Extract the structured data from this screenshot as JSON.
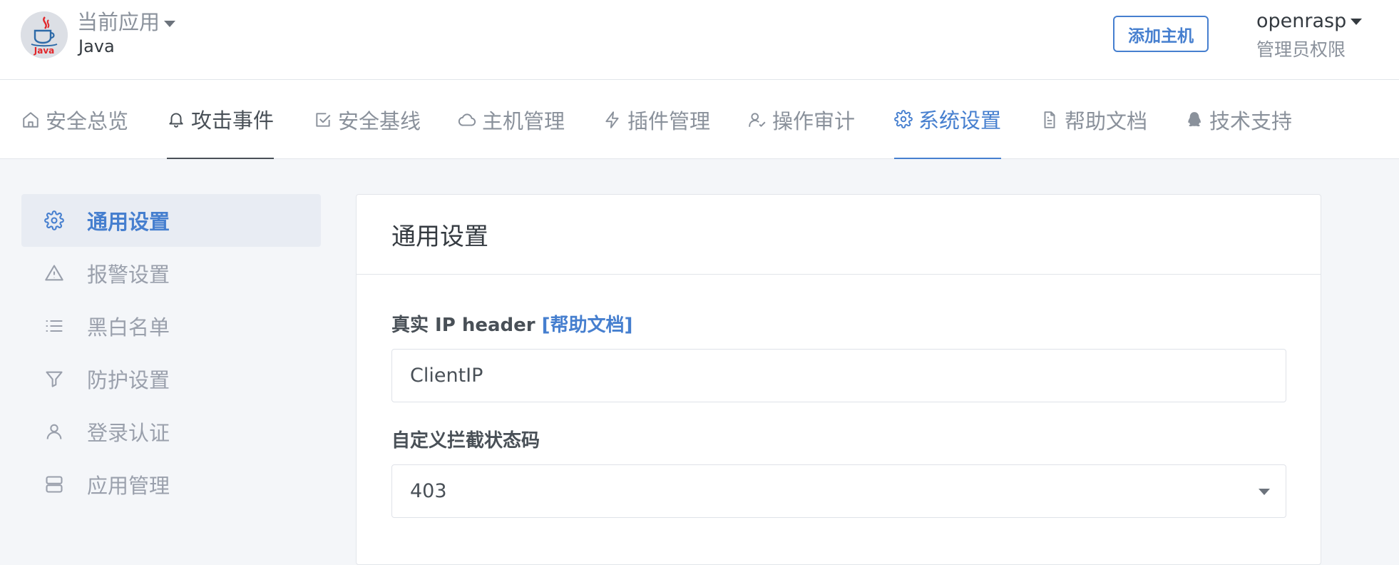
{
  "header": {
    "app_switch_label": "当前应用",
    "app_name": "Java",
    "logo_text": "Java",
    "add_host_label": "添加主机",
    "user_name": "openrasp",
    "user_role": "管理员权限"
  },
  "nav": {
    "items": [
      {
        "label": "安全总览",
        "icon": "home-icon"
      },
      {
        "label": "攻击事件",
        "icon": "bell-icon"
      },
      {
        "label": "安全基线",
        "icon": "check-square-icon"
      },
      {
        "label": "主机管理",
        "icon": "cloud-icon"
      },
      {
        "label": "插件管理",
        "icon": "lightning-icon"
      },
      {
        "label": "操作审计",
        "icon": "user-check-icon"
      },
      {
        "label": "系统设置",
        "icon": "gear-icon"
      },
      {
        "label": "帮助文档",
        "icon": "document-icon"
      },
      {
        "label": "技术支持",
        "icon": "qq-icon"
      }
    ],
    "active": "系统设置"
  },
  "sidebar": {
    "items": [
      {
        "label": "通用设置",
        "icon": "gear-icon"
      },
      {
        "label": "报警设置",
        "icon": "warning-icon"
      },
      {
        "label": "黑白名单",
        "icon": "list-icon"
      },
      {
        "label": "防护设置",
        "icon": "filter-icon"
      },
      {
        "label": "登录认证",
        "icon": "user-icon"
      },
      {
        "label": "应用管理",
        "icon": "server-icon"
      }
    ],
    "active": "通用设置"
  },
  "main": {
    "card_title": "通用设置",
    "real_ip_label": "真实 IP header",
    "real_ip_help": "[帮助文档]",
    "real_ip_value": "ClientIP",
    "status_code_label": "自定义拦截状态码",
    "status_code_value": "403"
  },
  "colors": {
    "accent": "#467fcf",
    "text": "#495057",
    "muted": "#9aa0ac",
    "background": "#f4f6f9"
  }
}
